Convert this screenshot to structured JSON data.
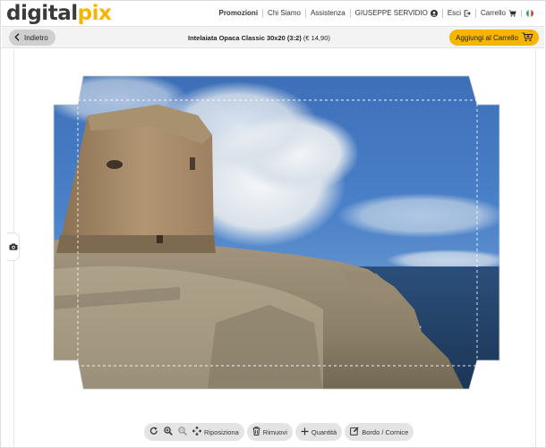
{
  "brand": {
    "part1": "digital",
    "part2": "pix",
    "accent": "#f7b500"
  },
  "nav": {
    "promo": "Promozioni",
    "about": "Chi Siamo",
    "help": "Assistenza",
    "user": "GIUSEPPE SERVIDIO",
    "logout": "Esci",
    "cart": "Carrello"
  },
  "subbar": {
    "back": "Indietro",
    "product_name": "Intelaiata Opaca Classic 30x20 (3:2)",
    "product_price": "(€ 14,90)",
    "add_to_cart": "Aggiungi al Carrello"
  },
  "toolbar": {
    "reposition": "Riposiziona",
    "remove": "Rimuovi",
    "quantity": "Quantità",
    "border": "Bordo / Cornice"
  },
  "icons": [
    "user-icon",
    "logout-icon",
    "cart-icon",
    "italy-flag-icon",
    "chevron-left-icon",
    "add-cart-icon",
    "camera-icon",
    "rotate-icon",
    "zoom-in-icon",
    "zoom-out-icon",
    "move-icon",
    "trash-icon",
    "plus-icon",
    "edit-icon"
  ]
}
